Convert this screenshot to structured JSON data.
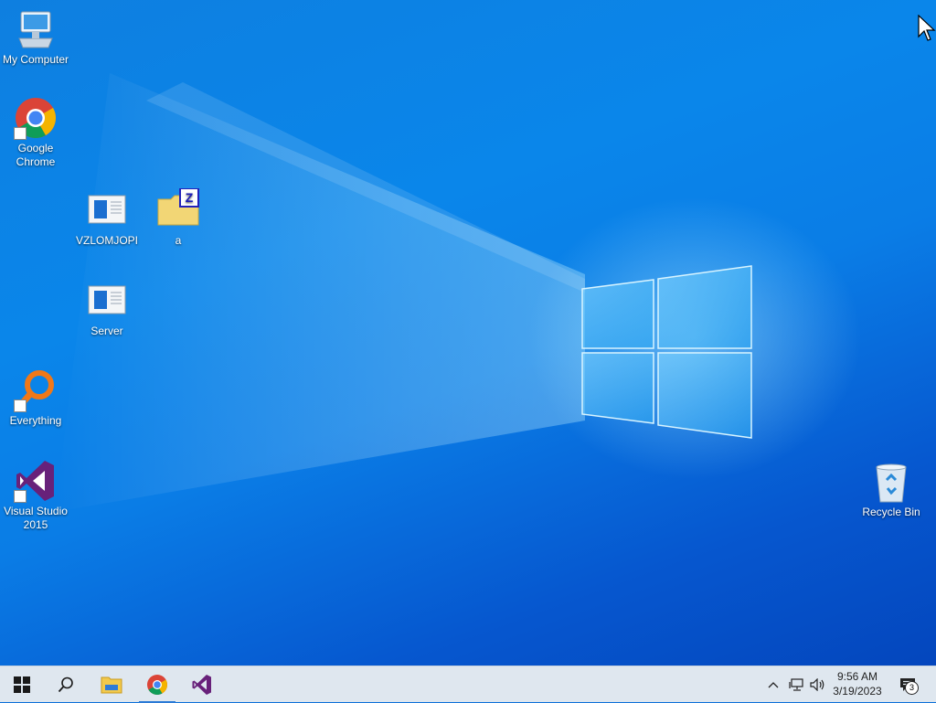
{
  "desktop_icons": {
    "my_computer": "My Computer",
    "google_chrome": "Google Chrome",
    "vzlomjopi": "VZLOMJOPI",
    "folder_a": "a",
    "server": "Server",
    "everything": "Everything",
    "visual_studio": "Visual Studio 2015",
    "recycle_bin": "Recycle Bin"
  },
  "taskbar": {
    "apps": [
      "start-icon",
      "search-icon",
      "file-explorer-icon",
      "chrome-icon",
      "visual-studio-icon"
    ],
    "active_app": "chrome-icon",
    "colors": {
      "background": "#dfe7ef",
      "active_indicator": "#2a7ad6"
    }
  },
  "tray": {
    "time": "9:56 AM",
    "date": "3/19/2023",
    "notification_count": "3"
  },
  "colors": {
    "wallpaper_primary": "#0a7de6",
    "wallpaper_dark": "#0446bd",
    "logo_light": "#bfeaff"
  }
}
